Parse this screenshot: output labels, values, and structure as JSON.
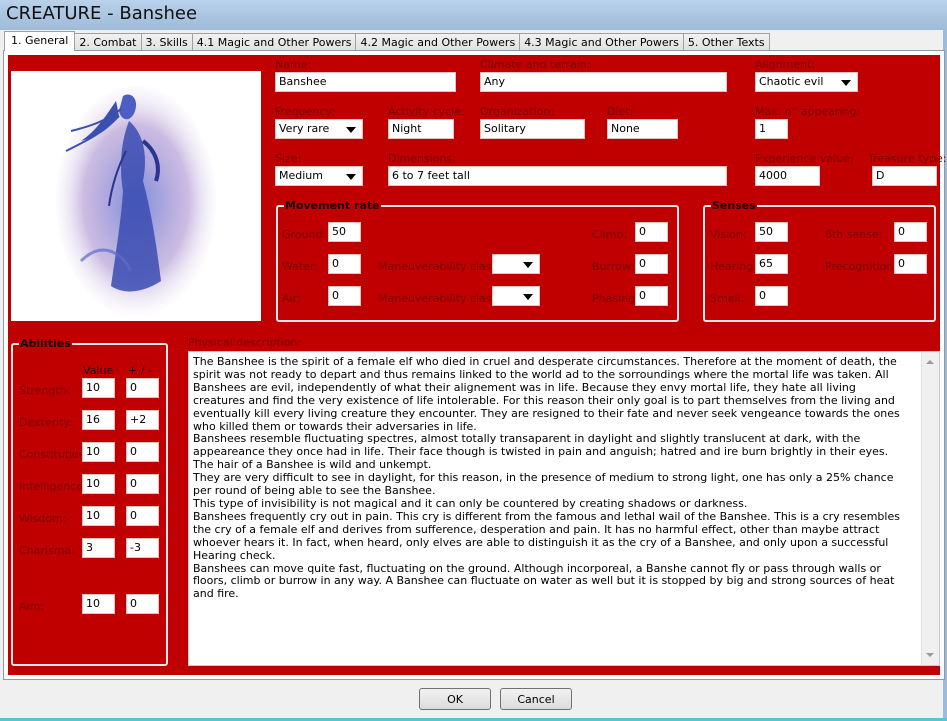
{
  "window": {
    "title": "CREATURE - Banshee"
  },
  "tabs": [
    {
      "label": "1. General",
      "active": true
    },
    {
      "label": "2. Combat"
    },
    {
      "label": "3. Skills"
    },
    {
      "label": "4.1 Magic and Other Powers"
    },
    {
      "label": "4.2 Magic and Other Powers"
    },
    {
      "label": "4.3 Magic and Other Powers"
    },
    {
      "label": "5. Other Texts"
    }
  ],
  "portrait": {
    "alt": "Banshee illustration",
    "icon": "banshee-portrait"
  },
  "general": {
    "name": {
      "label": "Name:",
      "value": "Banshee"
    },
    "climate": {
      "label": "Climate and terrain:",
      "value": "Any"
    },
    "alignment": {
      "label": "Alignment:",
      "value": "Chaotic evil"
    },
    "frequency": {
      "label": "Frequency:",
      "value": "Very rare"
    },
    "activity": {
      "label": "Activity cycle:",
      "value": "Night"
    },
    "organization": {
      "label": "Organization:",
      "value": "Solitary"
    },
    "diet": {
      "label": "Diet:",
      "value": "None"
    },
    "max_appearing": {
      "label": "Max. n° appearing:",
      "value": "1"
    },
    "size": {
      "label": "Size:",
      "value": "Medium"
    },
    "dimensions": {
      "label": "Dimensions:",
      "value": "6 to 7 feet tall"
    },
    "experience": {
      "label": "Experience value:",
      "value": "4000"
    },
    "treasure": {
      "label": "Treasure type:",
      "value": "D"
    }
  },
  "movement": {
    "title": "Movement rate",
    "ground": {
      "label": "Ground:",
      "value": "50"
    },
    "water": {
      "label": "Water:",
      "value": "0"
    },
    "air": {
      "label": "Air:",
      "value": "0"
    },
    "maneuver_water": {
      "label": "Maneuverability class:",
      "value": ""
    },
    "maneuver_air": {
      "label": "Maneuverability class:",
      "value": ""
    },
    "climb": {
      "label": "Climb:",
      "value": "0"
    },
    "burrow": {
      "label": "Burrow:",
      "value": "0"
    },
    "phasing": {
      "label": "Phasing:",
      "value": "0"
    }
  },
  "senses": {
    "title": "Senses",
    "vision": {
      "label": "Vision:",
      "value": "50"
    },
    "hearing": {
      "label": "Hearing:",
      "value": "65"
    },
    "smell": {
      "label": "Smell:",
      "value": "0"
    },
    "sixth": {
      "label": "6th sense:",
      "value": "0"
    },
    "precognition": {
      "label": "Precognition:",
      "value": "0"
    }
  },
  "abilities": {
    "title": "Abilities",
    "col_value": "Value",
    "col_mod": "+ / -",
    "rows": [
      {
        "label": "Strength:",
        "value": "10",
        "mod": "0"
      },
      {
        "label": "Dexterity:",
        "value": "16",
        "mod": "+2"
      },
      {
        "label": "Constitution:",
        "value": "10",
        "mod": "0"
      },
      {
        "label": "Intelligence:",
        "value": "10",
        "mod": "0"
      },
      {
        "label": "Wisdom:",
        "value": "10",
        "mod": "0"
      },
      {
        "label": "Charisma:",
        "value": "3",
        "mod": "-3"
      },
      {
        "label": "Aim:",
        "value": "10",
        "mod": "0"
      }
    ]
  },
  "description": {
    "label": "Physical description:",
    "text": "The Banshee is the spirit of a female elf who died in cruel and desperate circumstances. Therefore at the moment of death, the spirit was not ready to depart and thus remains linked to the world ad to the sorroundings where the mortal life was taken. All Banshees are evil, independently of what their alignement was in life. Because they envy mortal life, they hate all living creatures and find the very existence of life intolerable. For this reason their only goal is to part themselves from the living and eventually kill every living creature they encounter. They are resigned to their fate and never seek vengeance towards the ones who killed them or towards their adversaries in life.\nBanshees resemble fluctuating spectres, almost totally transaparent in daylight and slightly translucent at dark, with the appeareance they once had in life. Their face though is twisted in pain and anguish; hatred and ire burn brightly in their eyes. The hair of a Banshee is wild and unkempt.\nThey are very difficult to see in daylight, for this reason, in the presence of medium to strong light, one has only a 25% chance per round of being able to see the Banshee.\nThis type of invisibility is not magical and it can only be countered by creating shadows or darkness.\nBanshees frequently cry out in pain. This cry is different from the famous and lethal wail of the Banshee. This is a cry resembles the cry of a female elf and derives from sufference, desperation and pain. It has no harmful effect, other than maybe attract whoever hears it. In fact, when heard, only elves are able to distinguish it as the cry of a Banshee, and only upon a successful Hearing check.\nBanshees can move quite fast, fluctuating on the ground. Although incorporeal, a Banshe cannot fly or pass through walls or floors, climb or burrow in any way. A Banshee can fluctuate on water as well but it is stopped by big and strong sources of heat and fire."
  },
  "buttons": {
    "ok": "OK",
    "cancel": "Cancel"
  },
  "colors": {
    "panel": "#c00000",
    "label": "#7a0000"
  }
}
